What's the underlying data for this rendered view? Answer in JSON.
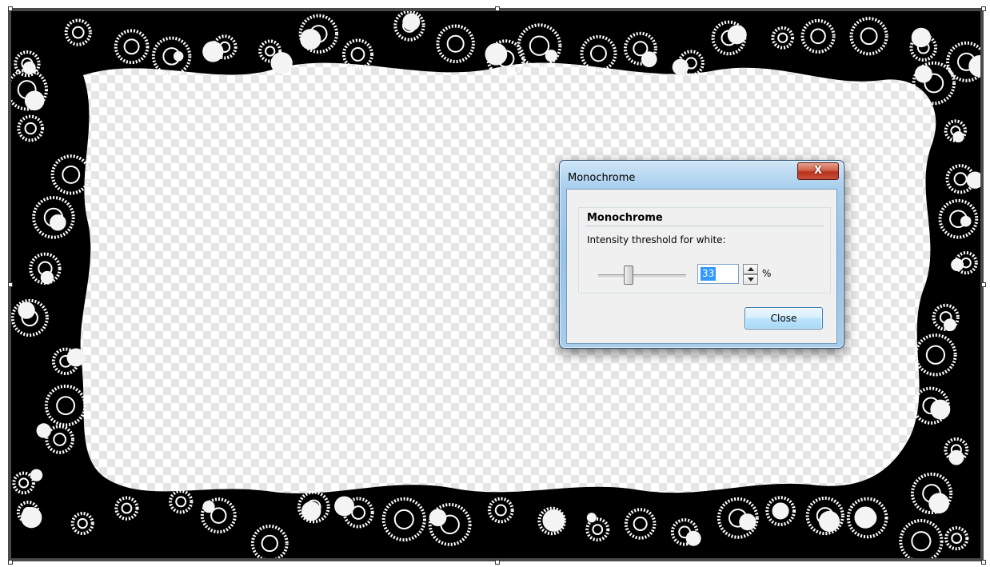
{
  "dialog": {
    "title": "Monochrome",
    "close_glyph": "X",
    "group_title": "Monochrome",
    "intensity_label": "Intensity threshold for white:",
    "threshold_value": "33",
    "threshold_unit": "%",
    "slider_level_percent": 33,
    "close_label": "Close"
  },
  "canvas": {
    "frame_color": "#4a4a4a",
    "pattern_color": "#000000",
    "ring_color": "#ffffff"
  },
  "icons": {
    "title_close": "close-icon",
    "spin_up": "arrow-up-icon",
    "spin_down": "arrow-down-icon"
  }
}
